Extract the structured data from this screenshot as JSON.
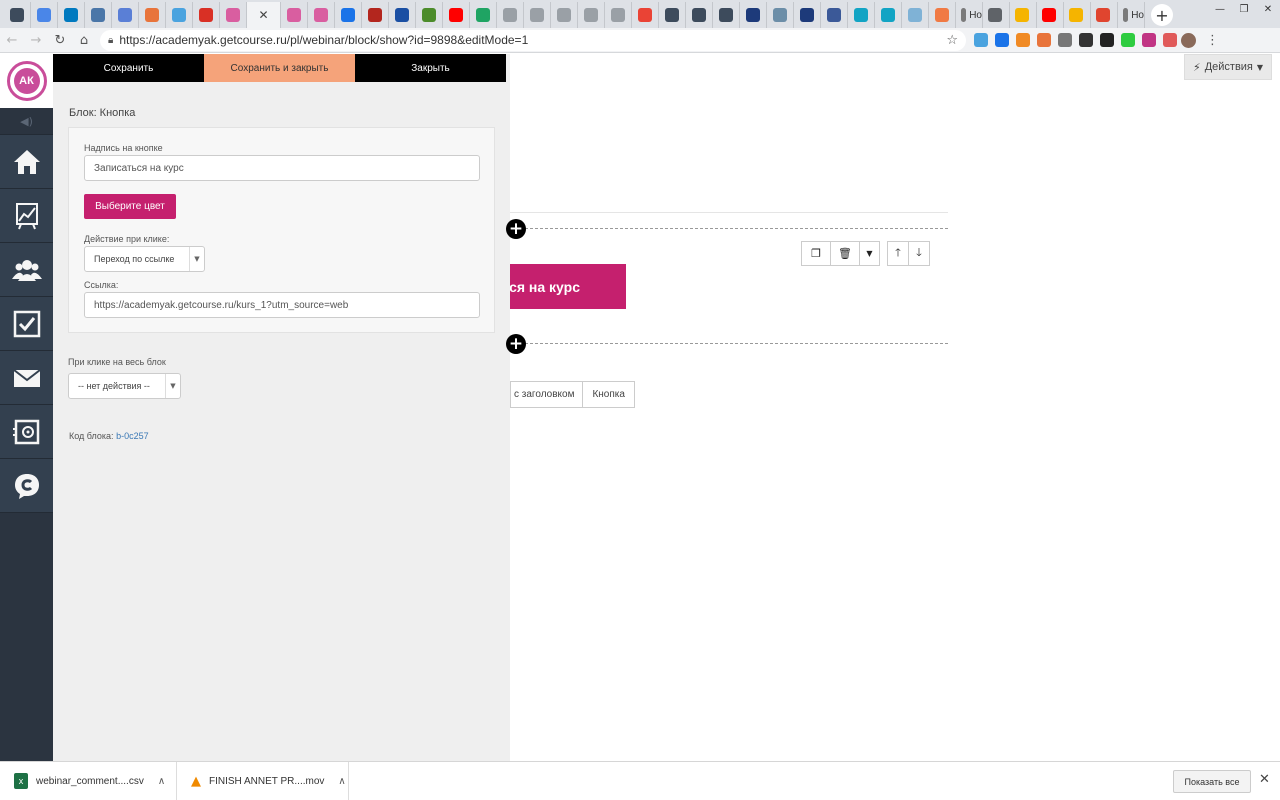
{
  "browser": {
    "tabs": [
      {
        "icon": "gc-icon",
        "color": "#3d4b5c"
      },
      {
        "icon": "heart-shield-icon",
        "color": "#4a86e8"
      },
      {
        "icon": "trello-icon",
        "color": "#0079bf"
      },
      {
        "icon": "vk-icon",
        "color": "#4a76a8"
      },
      {
        "icon": "pause-icon",
        "color": "#5a7fd6"
      },
      {
        "icon": "hand-icon",
        "color": "#e8743b"
      },
      {
        "icon": "window-icon",
        "color": "#4aa3df"
      },
      {
        "icon": "brand-red-icon",
        "color": "#d93025"
      },
      {
        "icon": "pink-shield-icon",
        "color": "#d95ea0"
      },
      {
        "icon": "pink-shield-icon",
        "color": "#d95ea0"
      },
      {
        "icon": "pink-shield-icon",
        "color": "#d95ea0"
      },
      {
        "icon": "mail-icon",
        "color": "#1a73e8"
      },
      {
        "icon": "mu-icon",
        "color": "#b3261e"
      },
      {
        "icon": "puzzle-icon",
        "color": "#1a4fa3"
      },
      {
        "icon": "owl-icon",
        "color": "#4c8c2b"
      },
      {
        "icon": "youtube-icon",
        "color": "#ff0000"
      },
      {
        "icon": "drive-icon",
        "color": "#1fa463"
      },
      {
        "icon": "diamond-icon",
        "color": "#9aa0a6"
      },
      {
        "icon": "diamond-icon",
        "color": "#9aa0a6"
      },
      {
        "icon": "diamond-icon",
        "color": "#9aa0a6"
      },
      {
        "icon": "diamond-icon",
        "color": "#9aa0a6"
      },
      {
        "icon": "diamond-icon",
        "color": "#9aa0a6"
      },
      {
        "icon": "gmail-icon",
        "color": "#ea4335"
      },
      {
        "icon": "gc-icon",
        "color": "#3d4b5c"
      },
      {
        "icon": "gc-icon",
        "color": "#3d4b5c"
      },
      {
        "icon": "gc-icon",
        "color": "#3d4b5c"
      },
      {
        "icon": "lightning-icon",
        "color": "#1d3a7a"
      },
      {
        "icon": "chat-icon",
        "color": "#6c8ea8"
      },
      {
        "icon": "lightning-icon",
        "color": "#1d3a7a"
      },
      {
        "icon": "facebook-icon",
        "color": "#3b5998"
      },
      {
        "icon": "cross-icon",
        "color": "#12a4c4"
      },
      {
        "icon": "cross-icon",
        "color": "#12a4c4"
      },
      {
        "icon": "telegram-icon",
        "color": "#7fb2d6"
      },
      {
        "icon": "orange-circle-icon",
        "color": "#f07a44"
      }
    ],
    "wide_tabs": [
      {
        "icon": "page-icon",
        "color": "#7a7a7a",
        "label": "Ho"
      },
      {
        "icon": "globe-icon",
        "color": "#5f6368"
      },
      {
        "icon": "folder-icon",
        "color": "#f5b400"
      },
      {
        "icon": "youtube-icon",
        "color": "#ff0000"
      },
      {
        "icon": "folder-icon",
        "color": "#f5b400"
      },
      {
        "icon": "gear-icon",
        "color": "#e0452f"
      },
      {
        "icon": "page-icon",
        "color": "#7a7a7a",
        "label": "Ho"
      }
    ],
    "url": "https://academyak.getcourse.ru/pl/webinar/block/show?id=9898&editMode=1",
    "extensions": [
      "#4aa3df",
      "#1a73e8",
      "#f08a24",
      "#e8743b",
      "#777777",
      "#333333",
      "#222222",
      "#2ecc40",
      "#c13584",
      "#e05a5a"
    ]
  },
  "sidebar": {
    "logo_text": "АК",
    "items": [
      {
        "name": "home-icon"
      },
      {
        "name": "chart-icon"
      },
      {
        "name": "users-icon"
      },
      {
        "name": "checkbox-icon"
      },
      {
        "name": "mail-icon"
      },
      {
        "name": "safe-icon"
      },
      {
        "name": "chat-icon"
      }
    ]
  },
  "panel": {
    "save_label": "Сохранить",
    "save_close_label": "Сохранить и закрыть",
    "close_label": "Закрыть",
    "block_title": "Блок: Кнопка",
    "button_text_label": "Надпись на кнопке",
    "button_text_value": "Записаться на курс",
    "choose_color_label": "Выберите цвет",
    "click_action_label": "Действие при клике:",
    "click_action_value": "Переход по ссылке",
    "link_label": "Ссылка:",
    "link_value": "https://academyak.getcourse.ru/kurs_1?utm_source=web",
    "block_click_label": "При клике на весь блок",
    "block_click_value": "-- нет действия --",
    "block_code_label": "Код блока:",
    "block_code_value": "b-0c257"
  },
  "canvas": {
    "actions_label": "Действия",
    "preview_button_text": "Записаться на курс",
    "breadcrumb_1": "с заголовком",
    "breadcrumb_2": "Кнопка"
  },
  "downloads": {
    "file1": "webinar_comment....csv",
    "file2": "FINISH ANNET PR....mov",
    "show_all": "Показать все"
  },
  "colors": {
    "accent_pink": "#c5206e",
    "sidebar_bg": "#2b3440",
    "save_close_bg": "#f5a37a"
  }
}
